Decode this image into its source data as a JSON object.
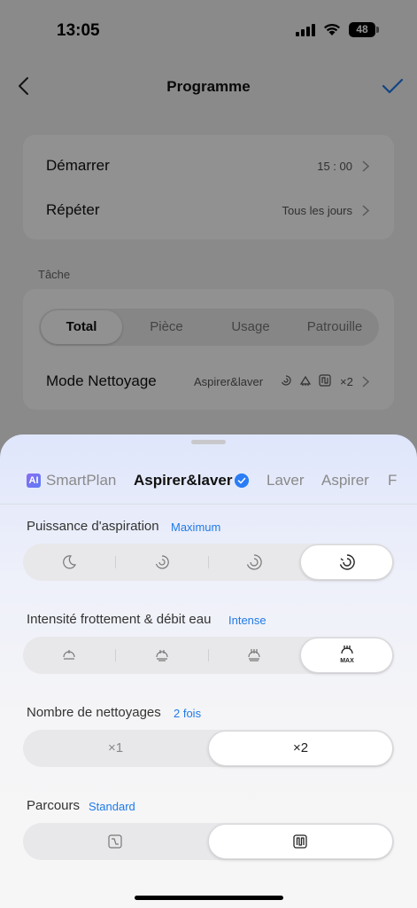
{
  "status": {
    "time": "13:05",
    "battery": "48"
  },
  "nav": {
    "title": "Programme"
  },
  "schedule": {
    "start_label": "Démarrer",
    "start_value": "15 : 00",
    "repeat_label": "Répéter",
    "repeat_value": "Tous les jours"
  },
  "task": {
    "section_label": "Tâche",
    "segments": [
      "Total",
      "Pièce",
      "Usage",
      "Patrouille"
    ],
    "selected_segment": "Total",
    "mode_label": "Mode Nettoyage",
    "mode_value": "Aspirer&laver",
    "mode_count": "×2",
    "mode_icons": [
      "suction-icon",
      "mop-icon",
      "route-icon"
    ]
  },
  "sheet": {
    "tabs": [
      {
        "label": "SmartPlan",
        "badge": "AI"
      },
      {
        "label": "Aspirer&laver",
        "selected": true
      },
      {
        "label": "Laver"
      },
      {
        "label": "Aspirer"
      },
      {
        "label": "F"
      }
    ],
    "suction": {
      "title": "Puissance d'aspiration",
      "value": "Maximum",
      "options": [
        "quiet-moon-icon",
        "standard-swirl-icon",
        "turbo-swirl-icon",
        "max-swirl-icon"
      ],
      "selected_index": 3
    },
    "scrub": {
      "title": "Intensité frottement & débit eau",
      "value": "Intense",
      "options": [
        "low-water-icon",
        "medium-water-icon",
        "high-water-icon",
        "max-water-icon"
      ],
      "max_label": "MAX",
      "selected_index": 3
    },
    "passes": {
      "title": "Nombre de nettoyages",
      "value": "2 fois",
      "options": [
        "×1",
        "×2"
      ],
      "selected_index": 1
    },
    "route": {
      "title": "Parcours",
      "value": "Standard",
      "options": [
        "quick-route-icon",
        "standard-route-icon"
      ],
      "selected_index": 1
    }
  },
  "colors": {
    "accent": "#1f7ae8",
    "check": "#2a7df5",
    "ai_badge": "#7a6cf5"
  }
}
